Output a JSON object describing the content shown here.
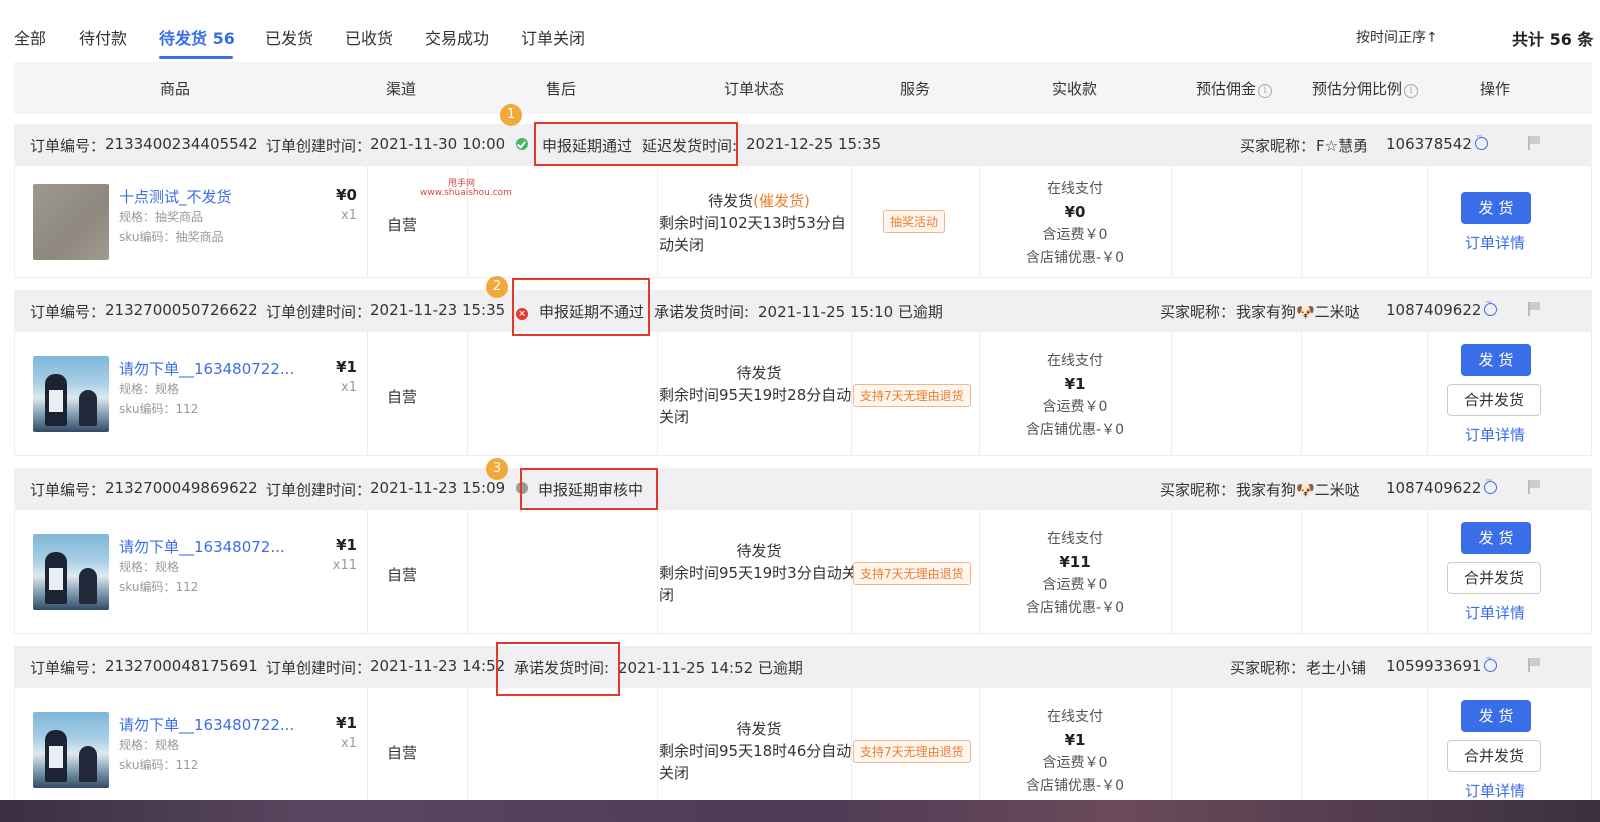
{
  "tabs": [
    {
      "label": "全部"
    },
    {
      "label": "待付款"
    },
    {
      "label": "待发货 56"
    },
    {
      "label": "已发货"
    },
    {
      "label": "已收货"
    },
    {
      "label": "交易成功"
    },
    {
      "label": "订单关闭"
    }
  ],
  "sort_label": "按时间正序↑",
  "total_label": "共计 56 条",
  "columns": {
    "product": "商品",
    "channel": "渠道",
    "aftersale": "售后",
    "order_status": "订单状态",
    "service": "服务",
    "received": "实收款",
    "commission": "预估佣金",
    "share_ratio": "预估分佣比例",
    "action": "操作"
  },
  "labels": {
    "order_no": "订单编号：",
    "created_at": "订单创建时间：",
    "buyer": "买家昵称：",
    "ship_btn": "发 货",
    "merge_btn": "合并发货",
    "detail_link": "订单详情",
    "online_pay": "在线支付",
    "shipping_fee": "含运费￥0",
    "shop_discount": "含店铺优惠-￥0"
  },
  "watermark": {
    "line1": "甩手网",
    "line2": "www.shuaishou.com"
  },
  "orders": [
    {
      "order_no": "2133400234405542",
      "created_at": "2021-11-30 10:00",
      "delay_status": "申报延期通过",
      "delay_label": "延迟发货时间:",
      "delay_time": "2021-12-25 15:35",
      "buyer": "F☆慧勇",
      "buyer_id": "106378542",
      "badge": "1",
      "product": "十点测试_不发货",
      "spec": "规格：抽奖商品",
      "sku": "sku编码：抽奖商品",
      "price": "¥0",
      "qty": "x1",
      "channel": "自营",
      "status_main": "待发货",
      "status_urge": "(催发货)",
      "status_remain": "剩余时间102天13时53分自动关闭",
      "service_tag": "抽奖活动",
      "amount": "¥0"
    },
    {
      "order_no": "2132700050726622",
      "created_at": "2021-11-23 15:35",
      "delay_status": "申报延期不通过",
      "delay_label": "承诺发货时间:",
      "delay_time": "2021-11-25 15:10 已逾期",
      "buyer": "我家有狗🐶二米哒",
      "buyer_id": "1087409622",
      "badge": "2",
      "product": "请勿下单__163480722...",
      "spec": "规格：规格",
      "sku": "sku编码：112",
      "price": "¥1",
      "qty": "x1",
      "channel": "自营",
      "status_main": "待发货",
      "status_remain": "剩余时间95天19时28分自动关闭",
      "service_tag": "支持7天无理由退货",
      "amount": "¥1"
    },
    {
      "order_no": "2132700049869622",
      "created_at": "2021-11-23 15:09",
      "delay_status": "申报延期审核中",
      "buyer": "我家有狗🐶二米哒",
      "buyer_id": "1087409622",
      "badge": "3",
      "product": "请勿下单__16348072...",
      "spec": "规格：规格",
      "sku": "sku编码：112",
      "price": "¥1",
      "qty": "x11",
      "channel": "自营",
      "status_main": "待发货",
      "status_remain": "剩余时间95天19时3分自动关闭",
      "service_tag": "支持7天无理由退货",
      "amount": "¥11"
    },
    {
      "order_no": "2132700048175691",
      "created_at": "2021-11-23 14:52",
      "delay_label": "承诺发货时间:",
      "delay_time": "2021-11-25 14:52 已逾期",
      "buyer": "老土小铺",
      "buyer_id": "1059933691",
      "product": "请勿下单__163480722...",
      "spec": "规格：规格",
      "sku": "sku编码：112",
      "price": "¥1",
      "qty": "x1",
      "channel": "自营",
      "status_main": "待发货",
      "status_remain": "剩余时间95天18时46分自动关闭",
      "service_tag": "支持7天无理由退货",
      "amount": "¥1"
    }
  ]
}
